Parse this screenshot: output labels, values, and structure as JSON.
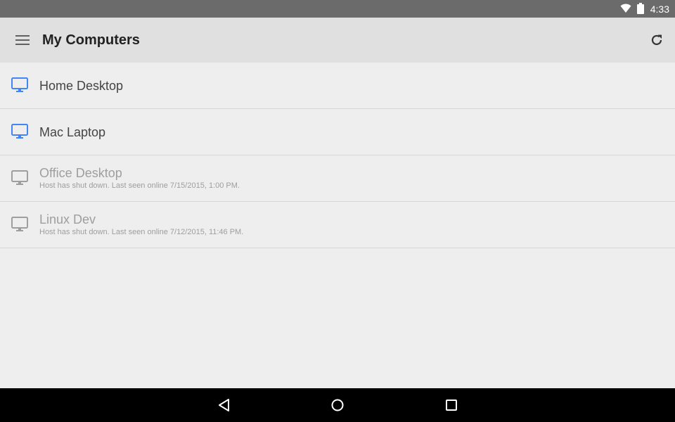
{
  "status_bar": {
    "time": "4:33",
    "icons": [
      "wifi-icon",
      "battery-icon"
    ]
  },
  "app_bar": {
    "title": "My Computers",
    "menu_icon": "hamburger-menu-icon",
    "refresh_icon": "refresh-icon"
  },
  "colors": {
    "online_icon": "#4285f4",
    "offline_icon": "#9e9e9e",
    "app_bar_bg": "#e0e0e0",
    "status_bar_bg": "#6b6b6b"
  },
  "hosts": [
    {
      "name": "Home Desktop",
      "status": "",
      "online": true,
      "icon": "monitor-icon"
    },
    {
      "name": "Mac Laptop",
      "status": "",
      "online": true,
      "icon": "monitor-icon"
    },
    {
      "name": "Office Desktop",
      "status": "Host has shut down. Last seen online 7/15/2015, 1:00 PM.",
      "online": false,
      "icon": "monitor-icon"
    },
    {
      "name": "Linux Dev",
      "status": "Host has shut down. Last seen online 7/12/2015, 11:46 PM.",
      "online": false,
      "icon": "monitor-icon"
    }
  ],
  "nav_bar": {
    "buttons": [
      "back-icon",
      "home-icon",
      "recents-icon"
    ]
  }
}
